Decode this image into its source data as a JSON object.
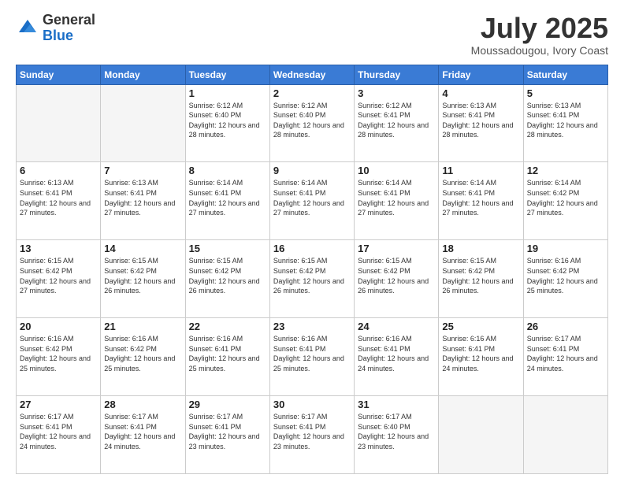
{
  "logo": {
    "general": "General",
    "blue": "Blue"
  },
  "header": {
    "month": "July 2025",
    "location": "Moussadougou, Ivory Coast"
  },
  "days_of_week": [
    "Sunday",
    "Monday",
    "Tuesday",
    "Wednesday",
    "Thursday",
    "Friday",
    "Saturday"
  ],
  "weeks": [
    [
      {
        "day": "",
        "info": ""
      },
      {
        "day": "",
        "info": ""
      },
      {
        "day": "1",
        "info": "Sunrise: 6:12 AM\nSunset: 6:40 PM\nDaylight: 12 hours and 28 minutes."
      },
      {
        "day": "2",
        "info": "Sunrise: 6:12 AM\nSunset: 6:40 PM\nDaylight: 12 hours and 28 minutes."
      },
      {
        "day": "3",
        "info": "Sunrise: 6:12 AM\nSunset: 6:41 PM\nDaylight: 12 hours and 28 minutes."
      },
      {
        "day": "4",
        "info": "Sunrise: 6:13 AM\nSunset: 6:41 PM\nDaylight: 12 hours and 28 minutes."
      },
      {
        "day": "5",
        "info": "Sunrise: 6:13 AM\nSunset: 6:41 PM\nDaylight: 12 hours and 28 minutes."
      }
    ],
    [
      {
        "day": "6",
        "info": "Sunrise: 6:13 AM\nSunset: 6:41 PM\nDaylight: 12 hours and 27 minutes."
      },
      {
        "day": "7",
        "info": "Sunrise: 6:13 AM\nSunset: 6:41 PM\nDaylight: 12 hours and 27 minutes."
      },
      {
        "day": "8",
        "info": "Sunrise: 6:14 AM\nSunset: 6:41 PM\nDaylight: 12 hours and 27 minutes."
      },
      {
        "day": "9",
        "info": "Sunrise: 6:14 AM\nSunset: 6:41 PM\nDaylight: 12 hours and 27 minutes."
      },
      {
        "day": "10",
        "info": "Sunrise: 6:14 AM\nSunset: 6:41 PM\nDaylight: 12 hours and 27 minutes."
      },
      {
        "day": "11",
        "info": "Sunrise: 6:14 AM\nSunset: 6:41 PM\nDaylight: 12 hours and 27 minutes."
      },
      {
        "day": "12",
        "info": "Sunrise: 6:14 AM\nSunset: 6:42 PM\nDaylight: 12 hours and 27 minutes."
      }
    ],
    [
      {
        "day": "13",
        "info": "Sunrise: 6:15 AM\nSunset: 6:42 PM\nDaylight: 12 hours and 27 minutes."
      },
      {
        "day": "14",
        "info": "Sunrise: 6:15 AM\nSunset: 6:42 PM\nDaylight: 12 hours and 26 minutes."
      },
      {
        "day": "15",
        "info": "Sunrise: 6:15 AM\nSunset: 6:42 PM\nDaylight: 12 hours and 26 minutes."
      },
      {
        "day": "16",
        "info": "Sunrise: 6:15 AM\nSunset: 6:42 PM\nDaylight: 12 hours and 26 minutes."
      },
      {
        "day": "17",
        "info": "Sunrise: 6:15 AM\nSunset: 6:42 PM\nDaylight: 12 hours and 26 minutes."
      },
      {
        "day": "18",
        "info": "Sunrise: 6:15 AM\nSunset: 6:42 PM\nDaylight: 12 hours and 26 minutes."
      },
      {
        "day": "19",
        "info": "Sunrise: 6:16 AM\nSunset: 6:42 PM\nDaylight: 12 hours and 25 minutes."
      }
    ],
    [
      {
        "day": "20",
        "info": "Sunrise: 6:16 AM\nSunset: 6:42 PM\nDaylight: 12 hours and 25 minutes."
      },
      {
        "day": "21",
        "info": "Sunrise: 6:16 AM\nSunset: 6:42 PM\nDaylight: 12 hours and 25 minutes."
      },
      {
        "day": "22",
        "info": "Sunrise: 6:16 AM\nSunset: 6:41 PM\nDaylight: 12 hours and 25 minutes."
      },
      {
        "day": "23",
        "info": "Sunrise: 6:16 AM\nSunset: 6:41 PM\nDaylight: 12 hours and 25 minutes."
      },
      {
        "day": "24",
        "info": "Sunrise: 6:16 AM\nSunset: 6:41 PM\nDaylight: 12 hours and 24 minutes."
      },
      {
        "day": "25",
        "info": "Sunrise: 6:16 AM\nSunset: 6:41 PM\nDaylight: 12 hours and 24 minutes."
      },
      {
        "day": "26",
        "info": "Sunrise: 6:17 AM\nSunset: 6:41 PM\nDaylight: 12 hours and 24 minutes."
      }
    ],
    [
      {
        "day": "27",
        "info": "Sunrise: 6:17 AM\nSunset: 6:41 PM\nDaylight: 12 hours and 24 minutes."
      },
      {
        "day": "28",
        "info": "Sunrise: 6:17 AM\nSunset: 6:41 PM\nDaylight: 12 hours and 24 minutes."
      },
      {
        "day": "29",
        "info": "Sunrise: 6:17 AM\nSunset: 6:41 PM\nDaylight: 12 hours and 23 minutes."
      },
      {
        "day": "30",
        "info": "Sunrise: 6:17 AM\nSunset: 6:41 PM\nDaylight: 12 hours and 23 minutes."
      },
      {
        "day": "31",
        "info": "Sunrise: 6:17 AM\nSunset: 6:40 PM\nDaylight: 12 hours and 23 minutes."
      },
      {
        "day": "",
        "info": ""
      },
      {
        "day": "",
        "info": ""
      }
    ]
  ]
}
